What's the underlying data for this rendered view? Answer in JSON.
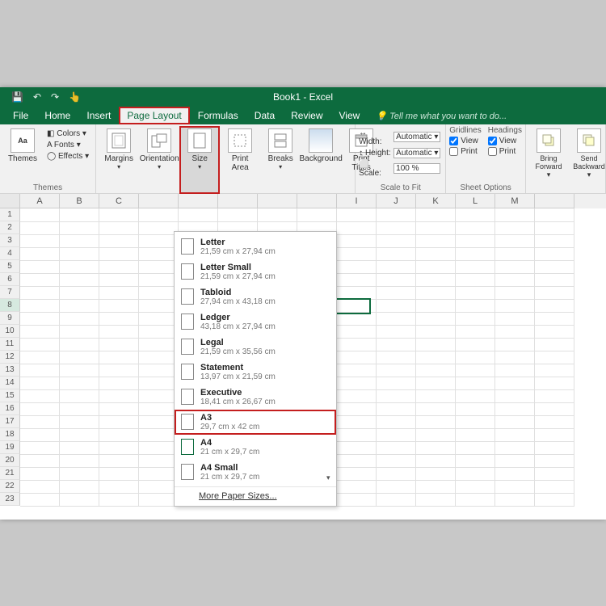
{
  "title": "Book1 - Excel",
  "qat": {
    "save": "💾",
    "undo": "↶",
    "redo": "↷",
    "touch": "👆"
  },
  "tabs": [
    "File",
    "Home",
    "Insert",
    "Page Layout",
    "Formulas",
    "Data",
    "Review",
    "View"
  ],
  "active_tab": "Page Layout",
  "tell_me": "Tell me what you want to do...",
  "ribbon": {
    "themes": {
      "label": "Themes",
      "btn": "Themes",
      "colors": "Colors ▾",
      "fonts": "Fonts ▾",
      "effects": "Effects ▾"
    },
    "page_setup": {
      "label": "",
      "margins": "Margins",
      "orientation": "Orientation",
      "size": "Size",
      "print_area": "Print\nArea",
      "breaks": "Breaks",
      "background": "Background",
      "print_titles": "Print\nTitles"
    },
    "scale": {
      "label": "Scale to Fit",
      "width": "Width:",
      "width_v": "Automatic ▾",
      "height": "Height:",
      "height_v": "Automatic ▾",
      "scale": "Scale:",
      "scale_v": "100 %"
    },
    "sheet_opts": {
      "label": "Sheet Options",
      "gridlines": "Gridlines",
      "headings": "Headings",
      "view": "View",
      "print": "Print",
      "g_view": true,
      "g_print": false,
      "h_view": true,
      "h_print": false
    },
    "arrange": {
      "bring": "Bring\nForward ▾",
      "send": "Send\nBackward ▾"
    }
  },
  "dropdown": {
    "items": [
      {
        "name": "Letter",
        "dim": "21,59 cm x 27,94 cm"
      },
      {
        "name": "Letter Small",
        "dim": "21,59 cm x 27,94 cm"
      },
      {
        "name": "Tabloid",
        "dim": "27,94 cm x 43,18 cm"
      },
      {
        "name": "Ledger",
        "dim": "43,18 cm x 27,94 cm"
      },
      {
        "name": "Legal",
        "dim": "21,59 cm x 35,56 cm"
      },
      {
        "name": "Statement",
        "dim": "13,97 cm x 21,59 cm"
      },
      {
        "name": "Executive",
        "dim": "18,41 cm x 26,67 cm"
      },
      {
        "name": "A3",
        "dim": "29,7 cm x 42 cm"
      },
      {
        "name": "A4",
        "dim": "21 cm x 29,7 cm"
      },
      {
        "name": "A4 Small",
        "dim": "21 cm x 29,7 cm"
      }
    ],
    "highlighted": "A3",
    "current": "A4",
    "more": "More Paper Sizes..."
  },
  "columns": [
    "A",
    "B",
    "C",
    "",
    "",
    "",
    "",
    "",
    "I",
    "J",
    "K",
    "L",
    "M",
    ""
  ],
  "rows": [
    1,
    2,
    3,
    4,
    5,
    6,
    7,
    8,
    9,
    10,
    11,
    12,
    13,
    14,
    15,
    16,
    17,
    18,
    19,
    20,
    21,
    22,
    23
  ],
  "selected_row": 8,
  "active_cell": {
    "col": 8,
    "row": 8
  }
}
